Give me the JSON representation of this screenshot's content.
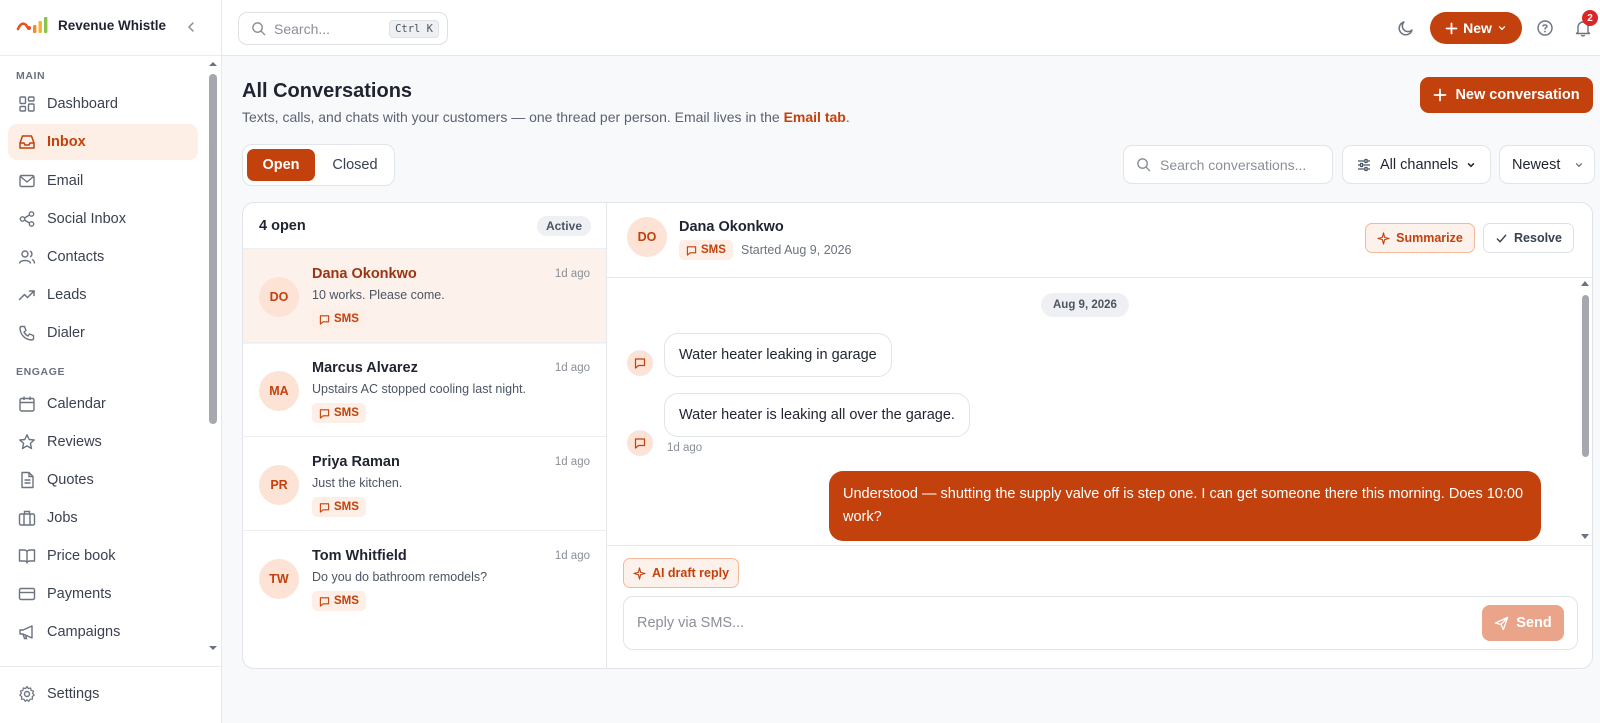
{
  "brand": {
    "name": "Revenue Whistle",
    "colors": {
      "accent": "#c2410c",
      "accent_soft": "#fdeee6"
    }
  },
  "sidebar": {
    "sections": [
      {
        "label": "MAIN"
      },
      {
        "label": "ENGAGE"
      }
    ],
    "items": [
      {
        "label": "Dashboard",
        "icon": "grid-icon",
        "active": false
      },
      {
        "label": "Inbox",
        "icon": "inbox-icon",
        "active": true
      },
      {
        "label": "Email",
        "icon": "mail-icon",
        "active": false
      },
      {
        "label": "Social Inbox",
        "icon": "share-icon",
        "active": false
      },
      {
        "label": "Contacts",
        "icon": "users-icon",
        "active": false
      },
      {
        "label": "Leads",
        "icon": "trending-icon",
        "active": false
      },
      {
        "label": "Dialer",
        "icon": "phone-icon",
        "active": false
      },
      {
        "label": "Calendar",
        "icon": "calendar-icon",
        "active": false
      },
      {
        "label": "Reviews",
        "icon": "star-icon",
        "active": false
      },
      {
        "label": "Quotes",
        "icon": "file-icon",
        "active": false
      },
      {
        "label": "Jobs",
        "icon": "briefcase-icon",
        "active": false
      },
      {
        "label": "Price book",
        "icon": "book-icon",
        "active": false
      },
      {
        "label": "Payments",
        "icon": "card-icon",
        "active": false
      },
      {
        "label": "Campaigns",
        "icon": "megaphone-icon",
        "active": false
      }
    ],
    "settings_label": "Settings"
  },
  "topbar": {
    "search_placeholder": "Search...",
    "shortcut": "Ctrl K",
    "new_label": "New",
    "notification_count": "2"
  },
  "page": {
    "title": "All Conversations",
    "subtitle_prefix": "Texts, calls, and chats with your customers — one thread per person. Email lives in the ",
    "subtitle_link": "Email tab",
    "subtitle_suffix": ".",
    "new_conversation_label": "New conversation"
  },
  "filters": {
    "tabs": [
      {
        "label": "Open",
        "selected": true
      },
      {
        "label": "Closed",
        "selected": false
      }
    ],
    "search_placeholder": "Search conversations...",
    "channel_label": "All channels",
    "sort_label": "Newest"
  },
  "list": {
    "count_label": "4 open",
    "status_label": "Active",
    "conversations": [
      {
        "initials": "DO",
        "name": "Dana Okonkwo",
        "time": "1d ago",
        "preview": "10 works. Please come.",
        "channel": "SMS",
        "selected": true
      },
      {
        "initials": "MA",
        "name": "Marcus Alvarez",
        "time": "1d ago",
        "preview": "Upstairs AC stopped cooling last night.",
        "channel": "SMS",
        "selected": false
      },
      {
        "initials": "PR",
        "name": "Priya Raman",
        "time": "1d ago",
        "preview": "Just the kitchen.",
        "channel": "SMS",
        "selected": false
      },
      {
        "initials": "TW",
        "name": "Tom Whitfield",
        "time": "1d ago",
        "preview": "Do you do bathroom remodels?",
        "channel": "SMS",
        "selected": false
      }
    ]
  },
  "thread": {
    "initials": "DO",
    "name": "Dana Okonkwo",
    "channel": "SMS",
    "started": "Started Aug 9, 2026",
    "summarize_label": "Summarize",
    "resolve_label": "Resolve",
    "date_divider": "Aug 9, 2026",
    "messages": [
      {
        "direction": "in",
        "text": "Water heater leaking in garage"
      },
      {
        "direction": "in",
        "text": "Water heater is leaking all over the garage.",
        "time": "1d ago"
      },
      {
        "direction": "out",
        "text": "Understood — shutting the supply valve off is step one. I can get someone there this morning. Does 10:00 work?"
      }
    ],
    "ai_draft_label": "AI draft reply",
    "reply_placeholder": "Reply via SMS...",
    "send_label": "Send"
  }
}
